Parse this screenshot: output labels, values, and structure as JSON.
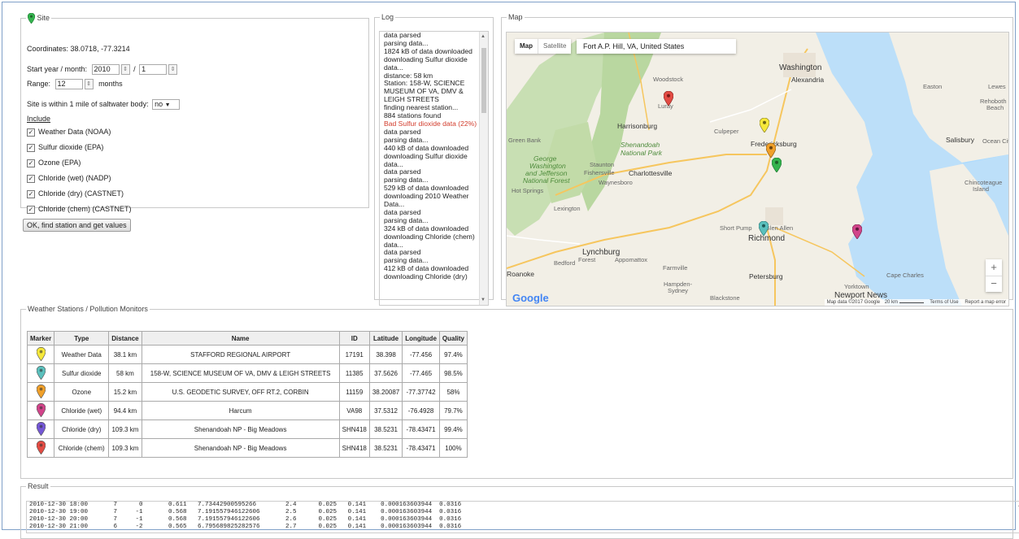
{
  "site": {
    "legend": "Site",
    "coordinates": "Coordinates: 38.0718, -77.3214",
    "start_label": "Start year / month:",
    "start_year": "2010",
    "separator": "/",
    "start_month": "1",
    "range_label": "Range:",
    "range_value": "12",
    "range_unit": "months",
    "saltwater_label": "Site is within 1 mile of saltwater body:",
    "saltwater_value": "no",
    "include_label": "Include",
    "includes": [
      "Weather Data (NOAA)",
      "Sulfur dioxide (EPA)",
      "Ozone (EPA)",
      "Chloride (wet) (NADP)",
      "Chloride (dry) (CASTNET)",
      "Chloride (chem) (CASTNET)"
    ],
    "button_label": "OK, find station and get values"
  },
  "log": {
    "legend": "Log",
    "lines": [
      "data parsed",
      "parsing data...",
      "1824 kB of data downloaded",
      "downloading Sulfur dioxide",
      "data...",
      "distance: 58 km",
      "Station: 158-W, SCIENCE",
      "MUSEUM OF VA, DMV &",
      "LEIGH STREETS",
      "finding nearest station...",
      "884 stations found",
      "Bad Sulfur dioxide data (22%)",
      "data parsed",
      "parsing data...",
      "440 kB of data downloaded",
      "downloading Sulfur dioxide",
      "data...",
      "data parsed",
      "parsing data...",
      "529 kB of data downloaded",
      "downloading 2010 Weather",
      "Data...",
      "data parsed",
      "parsing data...",
      "324 kB of data downloaded",
      "downloading Chloride (chem)",
      "data...",
      "data parsed",
      "parsing data...",
      "412 kB of data downloaded",
      "downloading Chloride (dry)"
    ]
  },
  "map": {
    "legend": "Map",
    "tab_map": "Map",
    "tab_satellite": "Satellite",
    "location": "Fort A.P. Hill, VA, United States",
    "labels": {
      "washington": "Washington",
      "alexandria": "Alexandria",
      "harrisonburg": "Harrisonburg",
      "culpeper": "Culpeper",
      "fredericksburg": "Fredericksburg",
      "luray": "Luray",
      "shenandoah": "Shenandoah",
      "national_park": "National Park",
      "george": "George",
      "washington2": "Washington",
      "and_jefferson": "and Jefferson",
      "national_forest": "National Forest",
      "staunton": "Staunton",
      "charlottesville": "Charlottesville",
      "waynesboro": "Waynesboro",
      "lexington": "Lexington",
      "hot_springs": "Hot Springs",
      "green_bank": "Green Bank",
      "short_pump": "Short Pump",
      "glen_allen": "Glen Allen",
      "richmond": "Richmond",
      "lynchburg": "Lynchburg",
      "bedford": "Bedford",
      "forest": "Forest",
      "appomattox": "Appomattox",
      "farmville": "Farmville",
      "petersburg": "Petersburg",
      "hampden_sydney": "Hampden-",
      "sydney": "Sydney",
      "blackstone": "Blackstone",
      "roanoke": "Roanoke",
      "newport_news": "Newport News",
      "yorktown": "Yorktown",
      "cape_charles": "Cape Charles",
      "easton": "Easton",
      "lewes": "Lewes",
      "rehoboth": "Rehoboth",
      "beach": "Beach",
      "salisbury": "Salisbury",
      "ocean_city": "Ocean City",
      "chincoteague": "Chincoteague",
      "island": "Island",
      "woodstock": "Woodstock",
      "fishersville": "Fishersville"
    },
    "zoom_in": "+",
    "zoom_out": "−",
    "google": "Google",
    "footer_data": "Map data ©2017 Google",
    "footer_scale": "20 km",
    "footer_terms": "Terms of Use",
    "footer_report": "Report a map error",
    "pin_colors": {
      "weather": "#f6e83a",
      "sulfur": "#5bc0bd",
      "ozone": "#f0a02a",
      "chloride_wet": "#d2448a",
      "chloride_dry": "#7457d6",
      "chloride_chem": "#e34b43",
      "site": "#34b34e"
    }
  },
  "stations": {
    "legend": "Weather Stations / Pollution Monitors",
    "headers": [
      "Marker",
      "Type",
      "Distance",
      "Name",
      "ID",
      "Latitude",
      "Longitude",
      "Quality"
    ],
    "rows": [
      {
        "type": "Weather Data",
        "distance": "38.1 km",
        "name": "STAFFORD REGIONAL AIRPORT",
        "id": "17191",
        "latitude": "38.398",
        "longitude": "-77.456",
        "quality": "97.4%",
        "color": "#f6e83a"
      },
      {
        "type": "Sulfur dioxide",
        "distance": "58 km",
        "name": "158-W, SCIENCE MUSEUM OF VA, DMV & LEIGH STREETS",
        "id": "11385",
        "latitude": "37.5626",
        "longitude": "-77.465",
        "quality": "98.5%",
        "color": "#5bc0bd"
      },
      {
        "type": "Ozone",
        "distance": "15.2 km",
        "name": "U.S. GEODETIC SURVEY, OFF RT.2, CORBIN",
        "id": "11159",
        "latitude": "38.20087",
        "longitude": "-77.37742",
        "quality": "58%",
        "color": "#f0a02a"
      },
      {
        "type": "Chloride (wet)",
        "distance": "94.4 km",
        "name": "Harcum",
        "id": "VA98",
        "latitude": "37.5312",
        "longitude": "-76.4928",
        "quality": "79.7%",
        "color": "#d2448a"
      },
      {
        "type": "Chloride (dry)",
        "distance": "109.3 km",
        "name": "Shenandoah NP - Big Meadows",
        "id": "SHN418",
        "latitude": "38.5231",
        "longitude": "-78.43471",
        "quality": "99.4%",
        "color": "#7457d6"
      },
      {
        "type": "Chloride (chem)",
        "distance": "109.3 km",
        "name": "Shenandoah NP - Big Meadows",
        "id": "SHN418",
        "latitude": "38.5231",
        "longitude": "-78.43471",
        "quality": "100%",
        "color": "#e34b43"
      }
    ]
  },
  "result": {
    "legend": "Result",
    "lines": [
      "2010-12-30 18:00       7      0       0.611   7.73442900595266        2.4      0.025   0.141    0.000163603944  0.0316",
      "2010-12-30 19:00       7     -1       0.568   7.191557946122606       2.5      0.025   0.141    0.000163603944  0.0316",
      "2010-12-30 20:00       7     -1       0.568   7.191557946122606       2.6      0.025   0.141    0.000163603944  0.0316",
      "2010-12-30 21:00       6     -2       0.565   6.795689825282576       2.7      0.025   0.141    0.000163603944  0.0316"
    ]
  }
}
